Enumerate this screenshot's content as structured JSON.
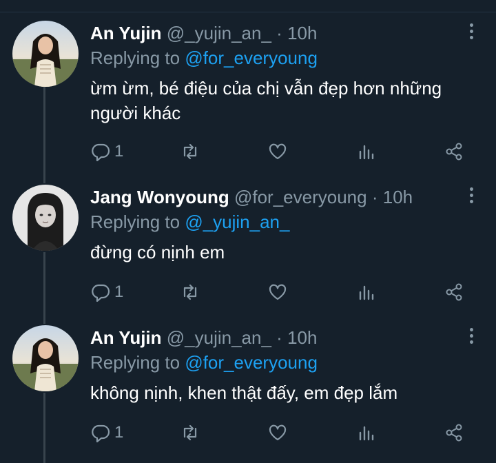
{
  "tweets": [
    {
      "name": "An Yujin",
      "handle": "@_yujin_an_",
      "dot": "·",
      "time": "10h",
      "replying_prefix": "Replying to",
      "replying_to": "@for_everyoung",
      "text": "ừm ừm, bé điệu của chị vẫn đẹp hơn những người khác",
      "reply_count": "1",
      "avatar": "avatar-yujin"
    },
    {
      "name": "Jang Wonyoung",
      "handle": "@for_everyoung",
      "dot": "·",
      "time": "10h",
      "replying_prefix": "Replying to",
      "replying_to": "@_yujin_an_",
      "text": "đừng có nịnh em",
      "reply_count": "1",
      "avatar": "avatar-wonyoung"
    },
    {
      "name": "An Yujin",
      "handle": "@_yujin_an_",
      "dot": "·",
      "time": "10h",
      "replying_prefix": "Replying to",
      "replying_to": "@for_everyoung",
      "text": "không nịnh, khen thật đấy, em đẹp lắm",
      "reply_count": "1",
      "avatar": "avatar-yujin"
    }
  ],
  "icons": {
    "reply": "reply-icon",
    "retweet": "retweet-icon",
    "like": "heart-icon",
    "analytics": "analytics-icon",
    "share": "share-icon",
    "more": "more-vertical-icon"
  },
  "colors": {
    "background": "#15202b",
    "secondary_text": "#8899a6",
    "link": "#1da1f2",
    "thread_line": "#38444d"
  }
}
